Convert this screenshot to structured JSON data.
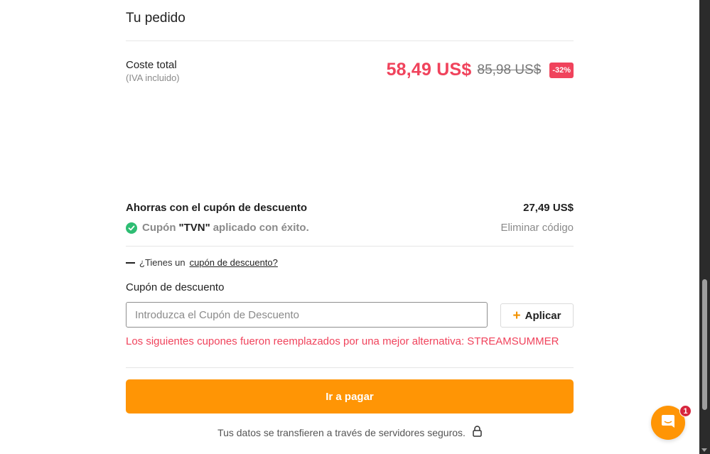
{
  "order": {
    "title": "Tu pedido",
    "total_label": "Coste total",
    "total_sub": "(IVA incluido)",
    "price_new": "58,49 US$",
    "price_old": "85,98 US$",
    "discount_badge": "-32%"
  },
  "savings": {
    "label": "Ahorras con el cupón de descuento",
    "value": "27,49 US$",
    "applied_prefix": "Cupón",
    "applied_code": "\"TVN\"",
    "applied_suffix": "aplicado con éxito.",
    "remove_label": "Eliminar código"
  },
  "coupon": {
    "question_prefix": "¿Tienes un",
    "question_link": "cupón de descuento?",
    "field_label": "Cupón de descuento",
    "placeholder": "Introduzca el Cupón de Descuento",
    "value": "",
    "apply_label": "Aplicar",
    "error_message": "Los siguientes cupones fueron reemplazados por una mejor alternativa: STREAMSUMMER"
  },
  "checkout": {
    "pay_label": "Ir a pagar",
    "secure_note": "Tus datos se transfieren a través de servidores seguros."
  },
  "chat": {
    "badge_count": "1"
  },
  "colors": {
    "accent_orange": "#ff9505",
    "price_red": "#f0435c",
    "success_green": "#2ebd73",
    "badge_red": "#d7263d"
  },
  "icons": [
    "check-icon",
    "minus-icon",
    "plus-icon",
    "lock-icon",
    "chat-icon",
    "scroll-down-icon"
  ]
}
